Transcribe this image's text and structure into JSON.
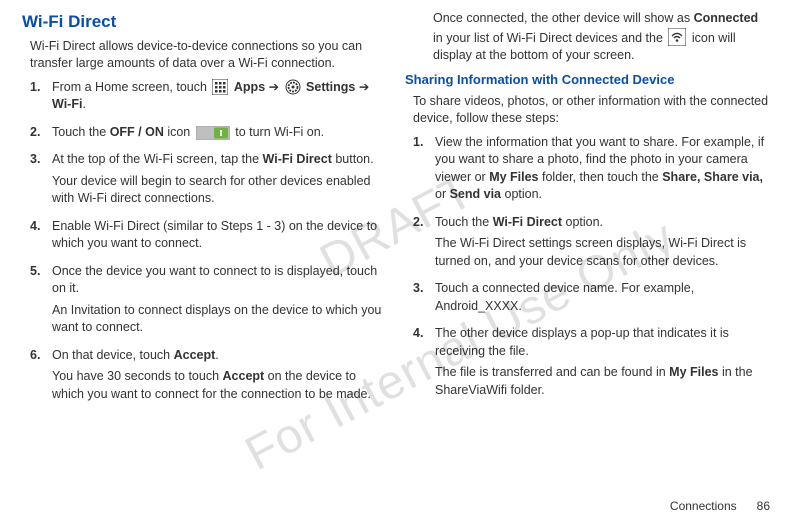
{
  "watermark_top": "DRAFT",
  "watermark_bottom": "For Internal Use Only",
  "left": {
    "heading": "Wi-Fi Direct",
    "intro": "Wi-Fi Direct allows device-to-device connections so you can transfer large amounts of data over a Wi-Fi connection.",
    "steps": [
      {
        "n": "1.",
        "parts": [
          {
            "t": "From a Home screen, touch "
          },
          {
            "icon": "apps-icon"
          },
          {
            "t": " ",
            "b": false
          },
          {
            "t": "Apps",
            "b": true
          },
          {
            "t": " ➔ "
          },
          {
            "icon": "settings-icon"
          },
          {
            "t": " "
          },
          {
            "t": "Settings",
            "b": true
          },
          {
            "t": " ➔ "
          },
          {
            "t": "Wi-Fi",
            "b": true
          },
          {
            "t": "."
          }
        ]
      },
      {
        "n": "2.",
        "parts": [
          {
            "t": "Touch the "
          },
          {
            "t": "OFF / ON",
            "b": true
          },
          {
            "t": " icon "
          },
          {
            "icon": "toggle-on-icon"
          },
          {
            "t": " to turn Wi-Fi on."
          }
        ]
      },
      {
        "n": "3.",
        "parts": [
          {
            "t": "At the top of the Wi-Fi screen, tap the "
          },
          {
            "t": "Wi-Fi Direct",
            "b": true
          },
          {
            "t": " button."
          }
        ],
        "after": "Your device will begin to search for other devices enabled with Wi-Fi direct connections."
      },
      {
        "n": "4.",
        "parts": [
          {
            "t": "Enable Wi-Fi Direct (similar to Steps 1 - 3) on the device to which you want to connect."
          }
        ]
      },
      {
        "n": "5.",
        "parts": [
          {
            "t": "Once the device you want to connect to is displayed, touch on it."
          }
        ],
        "after": "An Invitation to connect displays on the device to which you want to connect."
      },
      {
        "n": "6.",
        "parts": [
          {
            "t": "On that device, touch "
          },
          {
            "t": "Accept",
            "b": true
          },
          {
            "t": "."
          }
        ],
        "after_parts": [
          {
            "t": "You have 30 seconds to touch "
          },
          {
            "t": "Accept",
            "b": true
          },
          {
            "t": " on the device to which you want to connect for the connection to be made."
          }
        ]
      }
    ]
  },
  "right": {
    "top_parts": [
      {
        "t": "Once connected, the other device will show as "
      },
      {
        "t": "Connected",
        "b": true
      },
      {
        "t": " in your list of Wi-Fi Direct devices and the "
      },
      {
        "icon": "wifi-direct-status-icon"
      },
      {
        "t": " icon will display at the bottom of your screen."
      }
    ],
    "subheading": "Sharing Information with Connected Device",
    "intro": "To share videos, photos, or other information with the connected device, follow these steps:",
    "steps": [
      {
        "n": "1.",
        "parts": [
          {
            "t": "View the information that you want to share. For example, if you want to share a photo, find the photo in your camera viewer or "
          },
          {
            "t": "My Files",
            "b": true
          },
          {
            "t": " folder, then touch the "
          },
          {
            "t": "Share, Share via,",
            "b": true
          },
          {
            "t": " or "
          },
          {
            "t": "Send via",
            "b": true
          },
          {
            "t": " option."
          }
        ]
      },
      {
        "n": "2.",
        "parts": [
          {
            "t": "Touch the "
          },
          {
            "t": "Wi-Fi Direct",
            "b": true
          },
          {
            "t": " option."
          }
        ],
        "after": "The Wi-Fi Direct settings screen displays, Wi-Fi Direct is turned on, and your device scans for other devices."
      },
      {
        "n": "3.",
        "parts": [
          {
            "t": "Touch a connected device name. For example, Android_XXXX."
          }
        ]
      },
      {
        "n": "4.",
        "parts": [
          {
            "t": "The other device displays a pop-up that indicates it is receiving the file."
          }
        ],
        "after_parts": [
          {
            "t": "The file is transferred and can be found in "
          },
          {
            "t": "My Files",
            "b": true
          },
          {
            "t": " in the ShareViaWifi folder."
          }
        ]
      }
    ]
  },
  "footer_section": "Connections",
  "footer_page": "86"
}
